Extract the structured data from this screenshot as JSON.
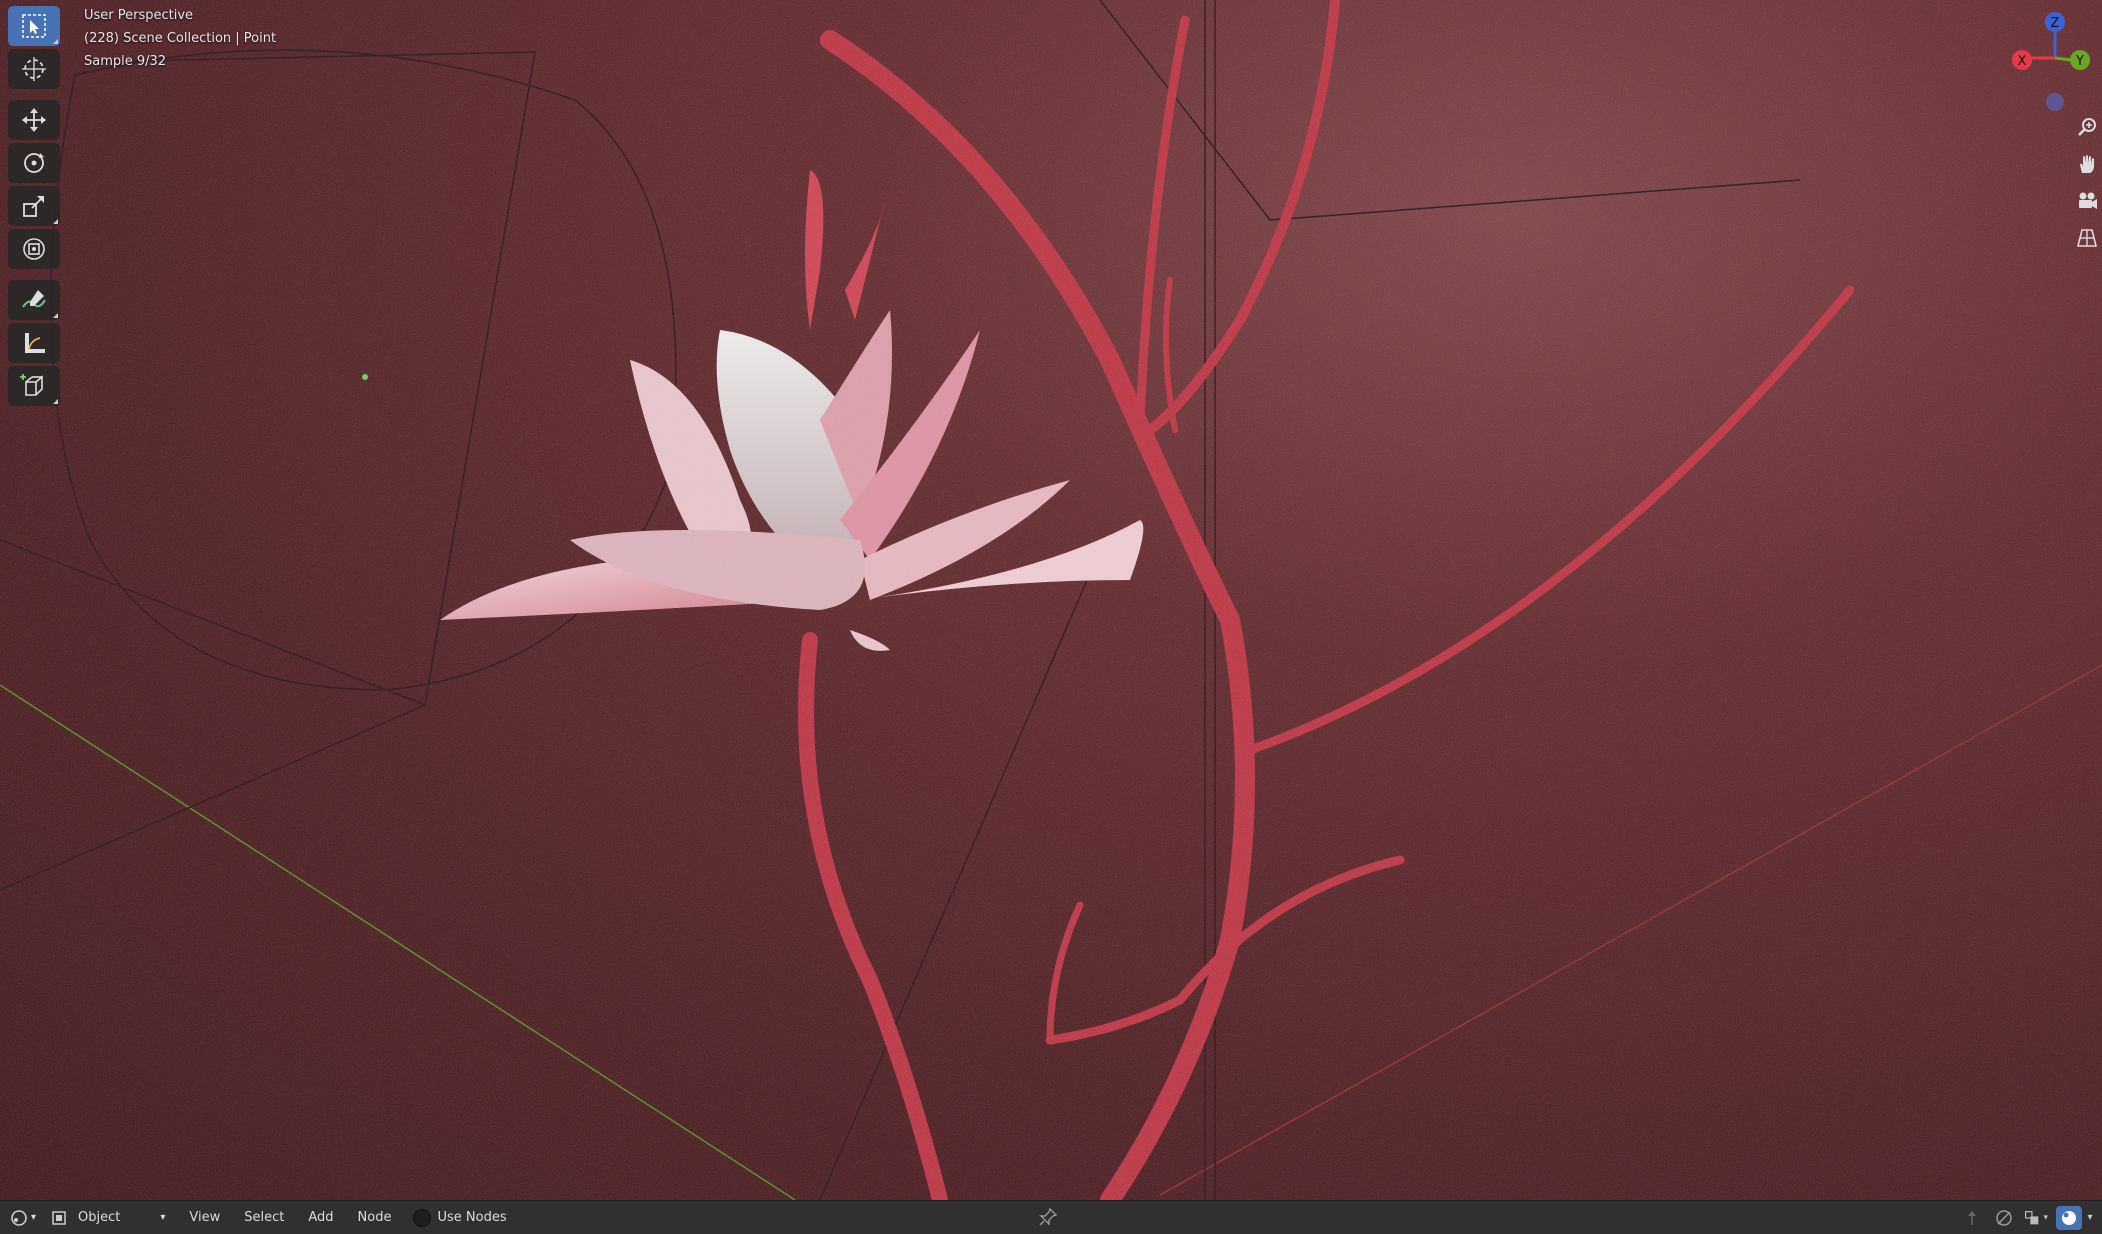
{
  "viewport": {
    "view_name": "User Perspective",
    "collection_info": "(228) Scene Collection | Point",
    "sample_info": "Sample 9/32"
  },
  "toolbar": {
    "tools": [
      "select-box",
      "cursor",
      "move",
      "rotate",
      "scale",
      "transform",
      "annotate",
      "measure",
      "add-cube"
    ],
    "active_tool": "select-box"
  },
  "gizmo": {
    "z_label": "Z",
    "x_label": "X",
    "y_label": "Y",
    "colors": {
      "x": "#e8394a",
      "y": "#6aa823",
      "z": "#3b62d6"
    }
  },
  "header": {
    "mode_label": "Object",
    "menus": {
      "view": "View",
      "select": "Select",
      "add": "Add",
      "node": "Node"
    },
    "use_nodes_label": "Use Nodes"
  },
  "colors": {
    "background": "#4a1b1e",
    "stem": "#b8303f",
    "petal": "#e8b5bd",
    "active_tool": "#4772b3",
    "header": "#303030"
  }
}
